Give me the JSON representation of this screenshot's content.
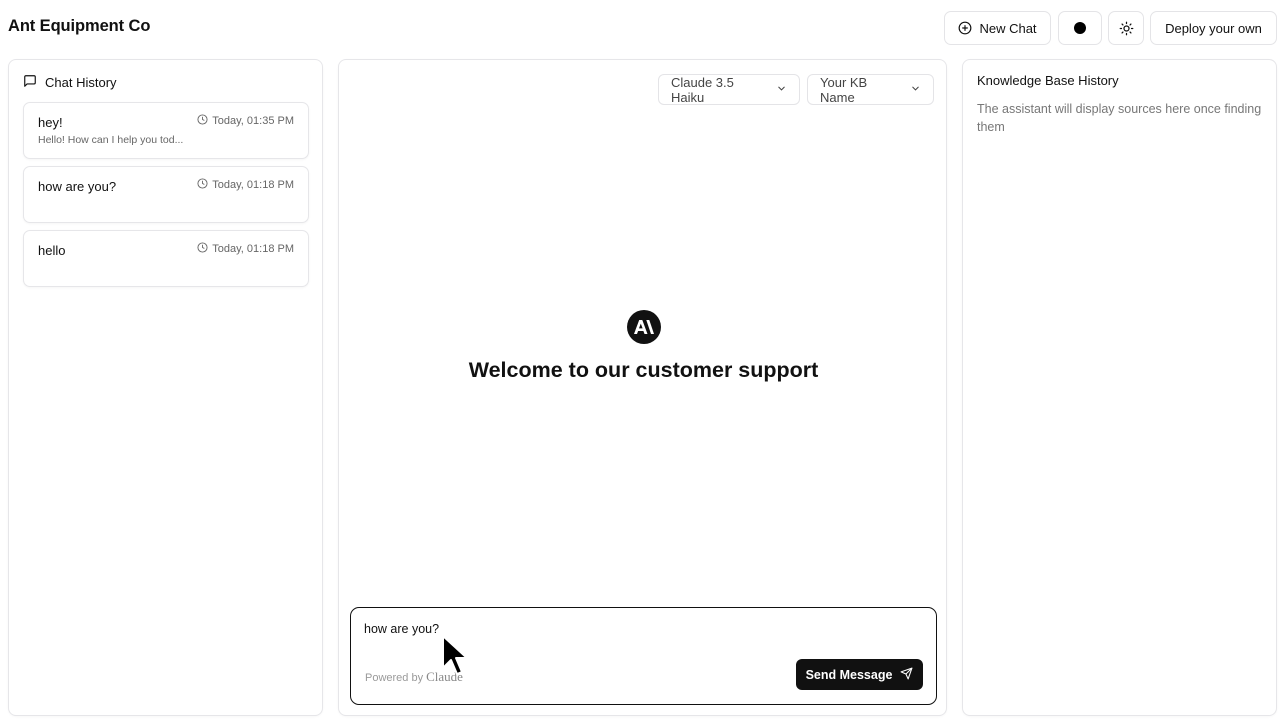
{
  "header": {
    "brand": "Ant Equipment Co",
    "new_chat_label": "New Chat",
    "deploy_label": "Deploy your own",
    "icons": {
      "new_chat": "plus-circle-icon",
      "theme_dot": "dot-icon",
      "theme_toggle": "sun-icon"
    }
  },
  "chat_history": {
    "title": "Chat History",
    "title_icon": "message-square-icon",
    "items": [
      {
        "title": "hey!",
        "timestamp": "Today, 01:35 PM",
        "preview": "Hello! How can I help you tod..."
      },
      {
        "title": "how are you?",
        "timestamp": "Today, 01:18 PM",
        "preview": ""
      },
      {
        "title": "hello",
        "timestamp": "Today, 01:18 PM",
        "preview": ""
      }
    ]
  },
  "main": {
    "model_select": "Claude 3.5 Haiku",
    "kb_select": "Your KB Name",
    "welcome": "Welcome to our customer support",
    "composer": {
      "value": "how are you?",
      "powered_by": "Powered by",
      "powered_brand": "Claude",
      "send_label": "Send Message"
    }
  },
  "knowledge_base": {
    "title": "Knowledge Base History",
    "empty_text": "The assistant will display sources here once finding them"
  },
  "colors": {
    "accent": "#111111",
    "border": "#e6e6e9",
    "muted_text": "#777777"
  }
}
